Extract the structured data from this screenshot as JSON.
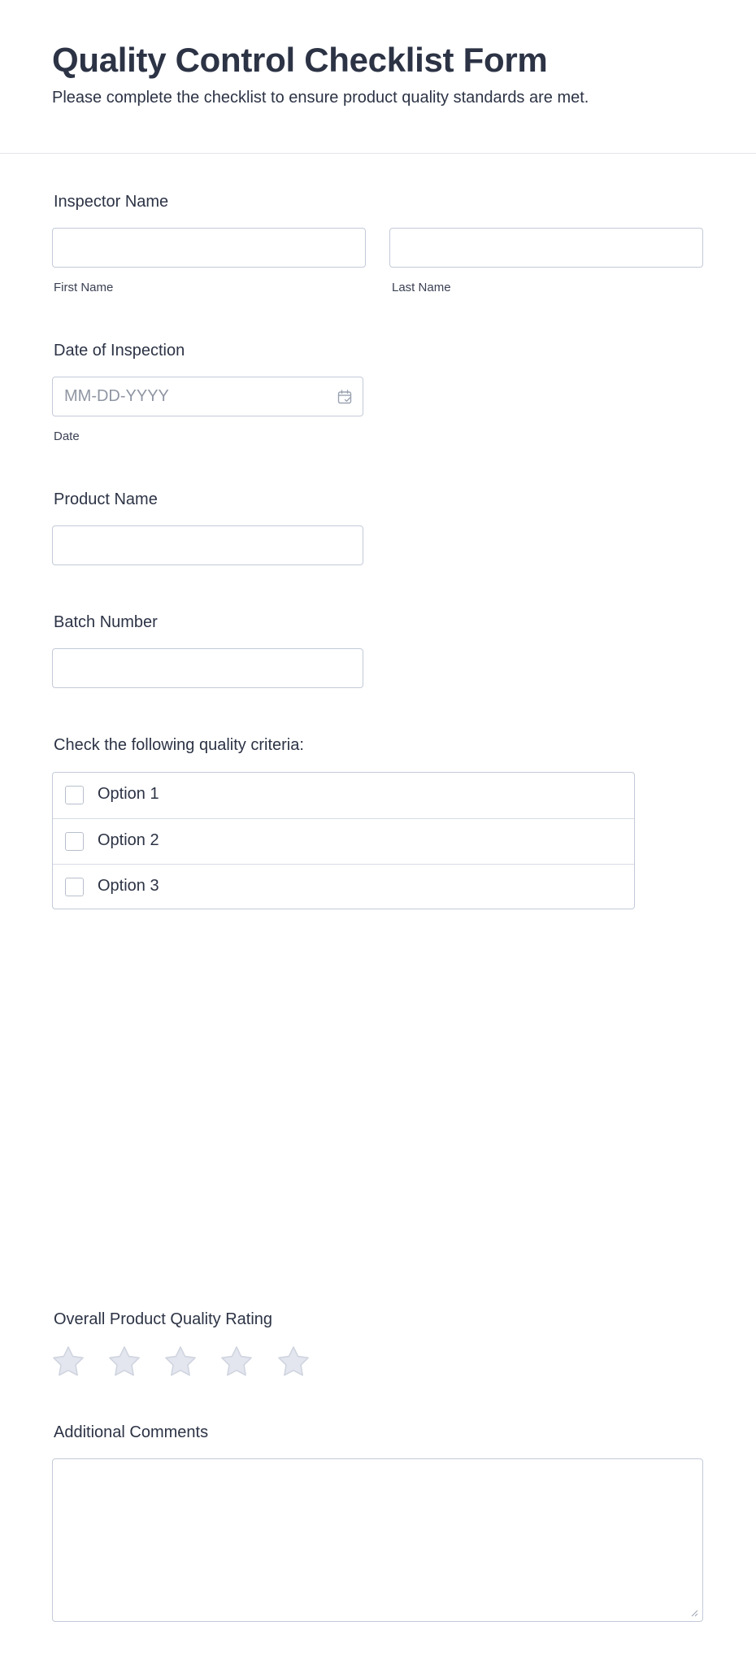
{
  "header": {
    "title": "Quality Control Checklist Form",
    "subtitle": "Please complete the checklist to ensure product quality standards are met."
  },
  "inspector": {
    "label": "Inspector Name",
    "first_value": "",
    "first_sublabel": "First Name",
    "last_value": "",
    "last_sublabel": "Last Name"
  },
  "date": {
    "label": "Date of Inspection",
    "placeholder": "MM-DD-YYYY",
    "sublabel": "Date",
    "icon": "calendar-icon"
  },
  "product": {
    "label": "Product Name",
    "value": ""
  },
  "batch": {
    "label": "Batch Number",
    "value": ""
  },
  "criteria": {
    "label": "Check the following quality criteria:",
    "options": [
      {
        "label": "Option 1",
        "checked": false
      },
      {
        "label": "Option 2",
        "checked": false
      },
      {
        "label": "Option 3",
        "checked": false
      }
    ]
  },
  "rating": {
    "label": "Overall Product Quality Rating",
    "max": 5,
    "value": 0,
    "icon": "star-icon",
    "empty_color": "#e3e6ee",
    "empty_stroke": "#cfd4df"
  },
  "comments": {
    "label": "Additional Comments",
    "value": ""
  }
}
